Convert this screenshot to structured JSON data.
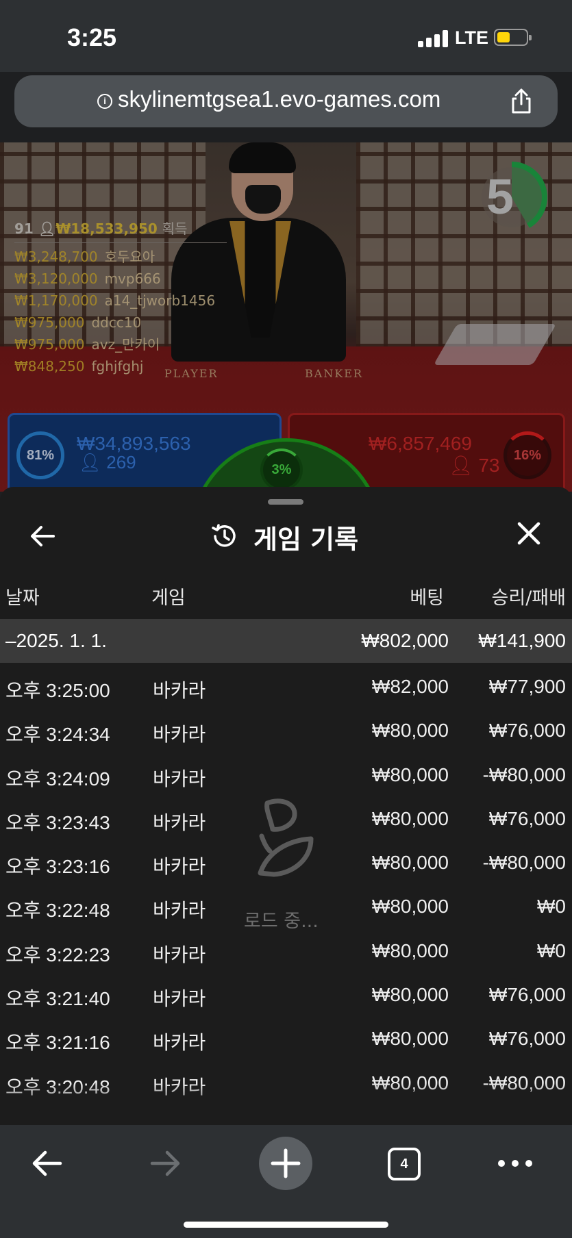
{
  "status": {
    "time": "3:25",
    "network": "LTE"
  },
  "browser": {
    "url": "skylinemtgsea1.evo-games.com",
    "tab_count": "4"
  },
  "live": {
    "countdown": "5",
    "table_labels": [
      "PLAYER",
      "BANKER"
    ],
    "winners_header": {
      "count": "91",
      "total": "₩18,533,950",
      "label": "획득"
    },
    "winners": [
      {
        "amount": "₩3,248,700",
        "name": "호두요아"
      },
      {
        "amount": "₩3,120,000",
        "name": "mvp666"
      },
      {
        "amount": "₩1,170,000",
        "name": "a14_tjworb1456"
      },
      {
        "amount": "₩975,000",
        "name": "ddcc10"
      },
      {
        "amount": "₩975,000",
        "name": "avz_만카이"
      },
      {
        "amount": "₩848,250",
        "name": "fghjfghj"
      }
    ],
    "player": {
      "percent": "81%",
      "amount": "₩34,893,563",
      "count": "269"
    },
    "banker": {
      "percent": "16%",
      "amount": "₩6,857,469",
      "count": "73"
    },
    "tie": {
      "percent": "3%"
    }
  },
  "history": {
    "title": "게임 기록",
    "columns": {
      "date": "날짜",
      "game": "게임",
      "bet": "베팅",
      "win_loss": "승리/패배"
    },
    "date_group": {
      "date": "–2025. 1. 1.",
      "bet": "₩802,000",
      "win_loss": "₩141,900"
    },
    "rows": [
      {
        "time": "오후 3:25:00",
        "game": "바카라",
        "bet": "₩82,000",
        "win_loss": "₩77,900"
      },
      {
        "time": "오후 3:24:34",
        "game": "바카라",
        "bet": "₩80,000",
        "win_loss": "₩76,000"
      },
      {
        "time": "오후 3:24:09",
        "game": "바카라",
        "bet": "₩80,000",
        "win_loss": "-₩80,000"
      },
      {
        "time": "오후 3:23:43",
        "game": "바카라",
        "bet": "₩80,000",
        "win_loss": "₩76,000"
      },
      {
        "time": "오후 3:23:16",
        "game": "바카라",
        "bet": "₩80,000",
        "win_loss": "-₩80,000"
      },
      {
        "time": "오후 3:22:48",
        "game": "바카라",
        "bet": "₩80,000",
        "win_loss": "₩0"
      },
      {
        "time": "오후 3:22:23",
        "game": "바카라",
        "bet": "₩80,000",
        "win_loss": "₩0"
      },
      {
        "time": "오후 3:21:40",
        "game": "바카라",
        "bet": "₩80,000",
        "win_loss": "₩76,000"
      },
      {
        "time": "오후 3:21:16",
        "game": "바카라",
        "bet": "₩80,000",
        "win_loss": "₩76,000"
      },
      {
        "time": "오후 3:20:48",
        "game": "바카라",
        "bet": "₩80,000",
        "win_loss": "-₩80,000"
      }
    ],
    "loading_text": "로드 중..."
  },
  "colors": {
    "player": "#2b62c2",
    "banker": "#b52222",
    "tie": "#1fa81f",
    "timer": "#22b14c"
  },
  "icons": [
    "info-icon",
    "share-icon",
    "back-arrow-icon",
    "history-icon",
    "close-icon",
    "loading-spinner-icon",
    "forward-arrow-icon",
    "plus-icon",
    "tabs-icon",
    "more-icon"
  ]
}
